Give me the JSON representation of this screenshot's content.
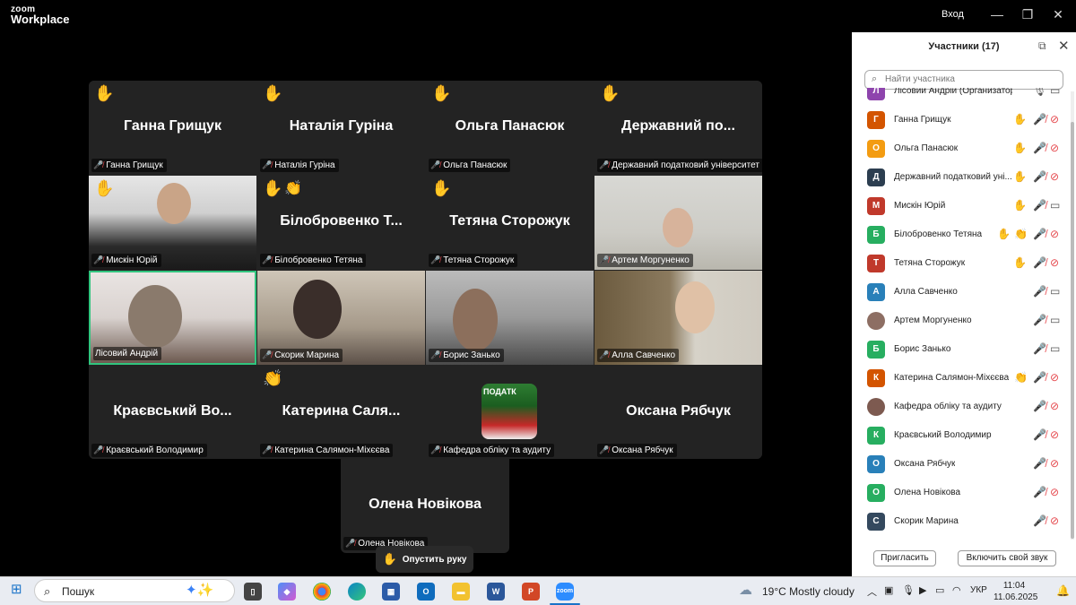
{
  "app": {
    "logo_line1": "zoom",
    "logo_line2": "Workplace",
    "signin": "Вход"
  },
  "window_controls": {
    "minimize": "—",
    "restore": "❐",
    "close": "✕"
  },
  "tiles": [
    {
      "name": "Ганна Грищук",
      "label": "Ганна Грищук",
      "hand": true
    },
    {
      "name": "Наталія Гуріна",
      "label": "Наталія Гуріна",
      "hand": true
    },
    {
      "name": "Ольга Панасюк",
      "label": "Ольга Панасюк",
      "hand": true
    },
    {
      "name": "Державний по...",
      "label": "Державний податковий університет",
      "hand": true
    },
    {
      "label": "Мискін Юрій",
      "hand": true
    },
    {
      "name": "Білобровенко Т...",
      "label": "Білобровенко Тетяна",
      "hand": true,
      "clap": true
    },
    {
      "name": "Тетяна Сторожук",
      "label": "Тетяна Сторожук",
      "hand": true
    },
    {
      "label": "Артем Моргуненко"
    },
    {
      "label": "Лісовий Андрій"
    },
    {
      "label": "Скорик Марина"
    },
    {
      "label": "Борис Занько"
    },
    {
      "label": "Алла Савченко"
    },
    {
      "name": "Краєвський Во...",
      "label": "Краєвський Володимир"
    },
    {
      "name": "Катерина  Саля...",
      "label": "Катерина Салямон-Міхєєва",
      "clap": true
    },
    {
      "label": "Кафедра обліку та аудиту",
      "logo_text": "ПОДАТК"
    },
    {
      "name": "Оксана Рябчук",
      "label": "Оксана Рябчук"
    },
    {
      "name": "Олена Новікова",
      "label": "Олена Новікова"
    }
  ],
  "raise_hand_button": "Опустить руку",
  "panel": {
    "title": "Участники (17)",
    "search_placeholder": "Найти участника",
    "participants": [
      {
        "initial": "Л",
        "name": "Лісовий Андрій (Организатор)",
        "color": "#8e44ad"
      },
      {
        "initial": "Г",
        "name": "Ганна Грищук",
        "color": "#d35400",
        "hand": true
      },
      {
        "initial": "О",
        "name": "Ольга Панасюк",
        "color": "#f39c12",
        "hand": true
      },
      {
        "initial": "Д",
        "name": "Державний податковий уні...",
        "color": "#2c3e50",
        "hand": true
      },
      {
        "initial": "М",
        "name": "Мискін Юрій",
        "color": "#c0392b",
        "hand": true
      },
      {
        "initial": "Б",
        "name": "Білобровенко Тетяна",
        "color": "#27ae60",
        "hand": true,
        "clap": true
      },
      {
        "initial": "Т",
        "name": "Тетяна Сторожук",
        "color": "#c0392b",
        "hand": true
      },
      {
        "initial": "А",
        "name": "Алла Савченко",
        "color": "#2980b9"
      },
      {
        "initial": "",
        "name": "Артем Моргуненко",
        "color": "#8d6e63"
      },
      {
        "initial": "Б",
        "name": "Борис Занько",
        "color": "#27ae60"
      },
      {
        "initial": "К",
        "name": "Катерина Салямон-Міхєєва",
        "color": "#d35400",
        "clap": true
      },
      {
        "initial": "",
        "name": "Кафедра обліку та аудиту",
        "color": "#7d5a50"
      },
      {
        "initial": "К",
        "name": "Краєвський Володимир",
        "color": "#27ae60"
      },
      {
        "initial": "О",
        "name": "Оксана Рябчук",
        "color": "#2980b9"
      },
      {
        "initial": "О",
        "name": "Олена Новікова",
        "color": "#27ae60"
      },
      {
        "initial": "С",
        "name": "Скорик Марина",
        "color": "#34495e"
      }
    ],
    "invite_button": "Пригласить",
    "unmute_button": "Включить свой звук"
  },
  "taskbar": {
    "search_label": "Пошук",
    "weather": "19°C  Mostly cloudy",
    "lang": "УКР",
    "time": "11:04",
    "date": "11.06.2025"
  }
}
